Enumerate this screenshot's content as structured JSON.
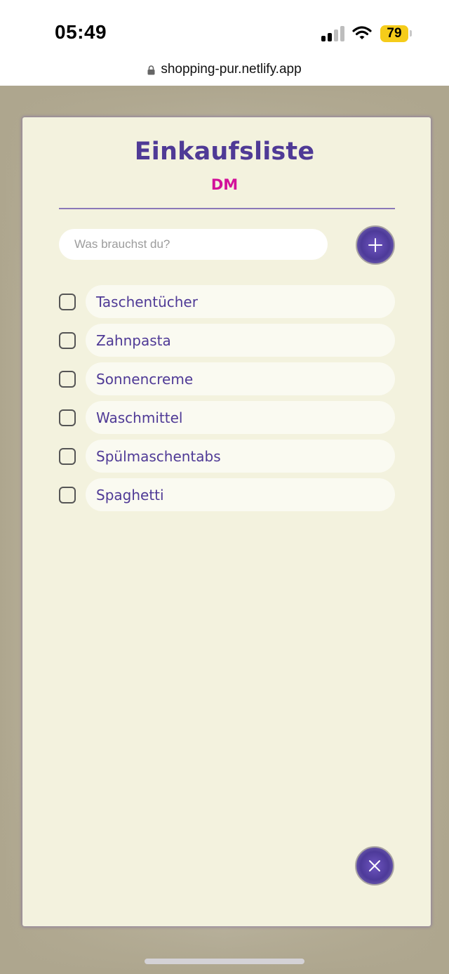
{
  "status_bar": {
    "time": "05:49",
    "battery": "79",
    "icons": [
      "signal-icon",
      "wifi-icon",
      "battery-icon"
    ]
  },
  "browser": {
    "url": "shopping-pur.netlify.app",
    "icon": "lock-icon"
  },
  "app": {
    "title": "Einkaufsliste",
    "subtitle": "DM",
    "input_placeholder": "Was brauchst du?",
    "add_icon": "plus-icon",
    "close_icon": "close-icon",
    "items": [
      {
        "label": "Taschentücher",
        "checked": false
      },
      {
        "label": "Zahnpasta",
        "checked": false
      },
      {
        "label": "Sonnencreme",
        "checked": false
      },
      {
        "label": "Waschmittel",
        "checked": false
      },
      {
        "label": "Spülmaschentabs",
        "checked": false
      },
      {
        "label": "Spaghetti",
        "checked": false
      }
    ]
  },
  "colors": {
    "title": "#4f3a96",
    "subtitle": "#d2119a",
    "card_background": "#f3f2de",
    "button": "#4d3a99",
    "battery": "#f5cc1a"
  }
}
